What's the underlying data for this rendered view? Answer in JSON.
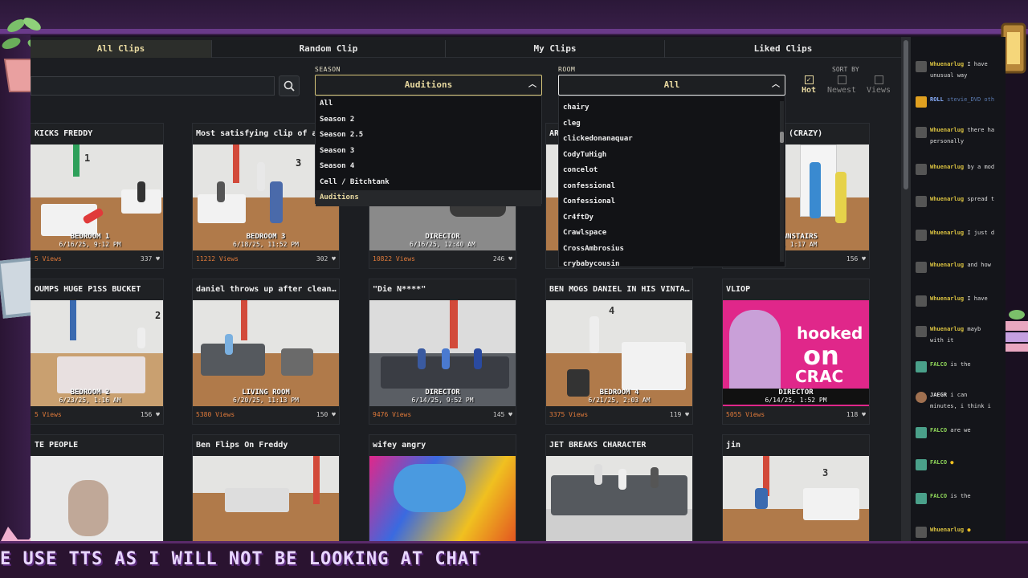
{
  "colors": {
    "accent": "#e8d9a0",
    "views": "#e07a3a",
    "tab_active_bg": "#2c2e2b",
    "chat_user_main": "#d8c040",
    "chat_user_alt": "#8fd65a"
  },
  "tabs": [
    {
      "label": "All Clips",
      "active": true
    },
    {
      "label": "Random Clip",
      "active": false
    },
    {
      "label": "My Clips",
      "active": false
    },
    {
      "label": "Liked Clips",
      "active": false
    }
  ],
  "filters": {
    "season_label": "SEASON",
    "season_value": "Auditions",
    "room_label": "ROOM",
    "room_value": "All",
    "search_icon": "search-icon"
  },
  "sort": {
    "label": "SORT BY",
    "options": [
      {
        "label": "Hot",
        "checked": true
      },
      {
        "label": "Newest",
        "checked": false
      },
      {
        "label": "Views",
        "checked": false
      }
    ]
  },
  "season_options": [
    "All",
    "Season 2",
    "Season 2.5",
    "Season 3",
    "Season 4",
    "Cell / Bitchtank",
    "Auditions"
  ],
  "room_options": [
    "chairy",
    "cleg",
    "clickedonanaquar",
    "CodyTuHigh",
    "concelot",
    "confessional",
    "Confessional",
    "Cr4ftDy",
    "Crawlspace",
    "CrossAmbrosius",
    "crybabycousin"
  ],
  "clips": [
    {
      "title": "KICKS FREDDY",
      "cam": "BEDROOM 1",
      "ts": "6/16/25, 9:12 PM",
      "views": "5 Views",
      "likes": "337"
    },
    {
      "title": "Most satisfying clip of all t",
      "cam": "BEDROOM 3",
      "ts": "6/18/25, 11:52 PM",
      "views": "11212 Views",
      "likes": "302"
    },
    {
      "title": "",
      "cam": "DIRECTOR",
      "ts": "6/16/25, 12:40 AM",
      "views": "10822 Views",
      "likes": "246"
    },
    {
      "title": "AR",
      "cam": "",
      "ts": "",
      "views": "",
      "likes": ""
    },
    {
      "title": "(CRAZY)",
      "cam": "DOWNSTAIRS",
      "ts": "25, 1:17 AM",
      "views": "",
      "likes": "156"
    },
    {
      "title": "OUMPS HUGE P1SS BUCKET",
      "cam": "BEDROOM 2",
      "ts": "6/23/25, 1:16 AM",
      "views": "5 Views",
      "likes": "156"
    },
    {
      "title": "daniel throws up after cleaning ...",
      "cam": "LIVING ROOM",
      "ts": "6/20/25, 11:13 PM",
      "views": "5380 Views",
      "likes": "150"
    },
    {
      "title": "\"Die N****\"",
      "cam": "DIRECTOR",
      "ts": "6/14/25, 9:52 PM",
      "views": "9476 Views",
      "likes": "145"
    },
    {
      "title": "BEN MOGS DANIEL IN HIS VINTAGE S...",
      "cam": "BEDROOM 4",
      "ts": "6/21/25, 2:03 AM",
      "views": "3375 Views",
      "likes": "119"
    },
    {
      "title": "VLIOP",
      "cam": "DIRECTOR",
      "ts": "6/14/25, 1:52 PM",
      "views": "5055 Views",
      "likes": "118"
    },
    {
      "title": "TE PEOPLE",
      "cam": "",
      "ts": "",
      "views": "",
      "likes": ""
    },
    {
      "title": "Ben Flips On Freddy",
      "cam": "",
      "ts": "",
      "views": "",
      "likes": ""
    },
    {
      "title": "wifey angry",
      "cam": "",
      "ts": "",
      "views": "",
      "likes": ""
    },
    {
      "title": "JET BREAKS CHARACTER",
      "cam": "",
      "ts": "",
      "views": "",
      "likes": ""
    },
    {
      "title": "jin",
      "cam": "",
      "ts": "",
      "views": "",
      "likes": ""
    }
  ],
  "thumb_text": {
    "room_1": "1",
    "room_3": "3",
    "room_2": "2",
    "room_4": "4",
    "room_3b": "3",
    "hooked": "hooked",
    "on": "on",
    "crack": "CRAC"
  },
  "chat": [
    {
      "user": "Whuenarlug",
      "msg": "I have",
      "msg2": "unusual way"
    },
    {
      "user": "ROLL",
      "msg": "stevie_DVD oth",
      "msg2": ""
    },
    {
      "user": "Whuenarlug",
      "msg": "there ha",
      "msg2": "personally"
    },
    {
      "user": "Whuenarlug",
      "msg": "by a mod",
      "msg2": ""
    },
    {
      "user": "Whuenarlug",
      "msg": "spread t",
      "msg2": ""
    },
    {
      "user": "Whuenarlug",
      "msg": "I just d",
      "msg2": ""
    },
    {
      "user": "Whuenarlug",
      "msg": "and how",
      "msg2": ""
    },
    {
      "user": "Whuenarlug",
      "msg": "I have",
      "msg2": ""
    },
    {
      "user": "Whuenarlug",
      "msg": "mayb",
      "msg2": "with it"
    },
    {
      "user": "FALCO",
      "msg": "is the",
      "msg2": ""
    },
    {
      "user": "JAEGR",
      "msg": "i can",
      "msg2": "minutes, i think i"
    },
    {
      "user": "FALCO",
      "msg": "are we",
      "msg2": ""
    },
    {
      "user": "FALCO",
      "msg": "",
      "msg2": ""
    },
    {
      "user": "FALCO",
      "msg": "is the",
      "msg2": ""
    },
    {
      "user": "Whuenarlug",
      "msg": "",
      "msg2": ""
    }
  ],
  "ticker": "E USE TTS AS I WILL NOT BE LOOKING AT CHAT"
}
